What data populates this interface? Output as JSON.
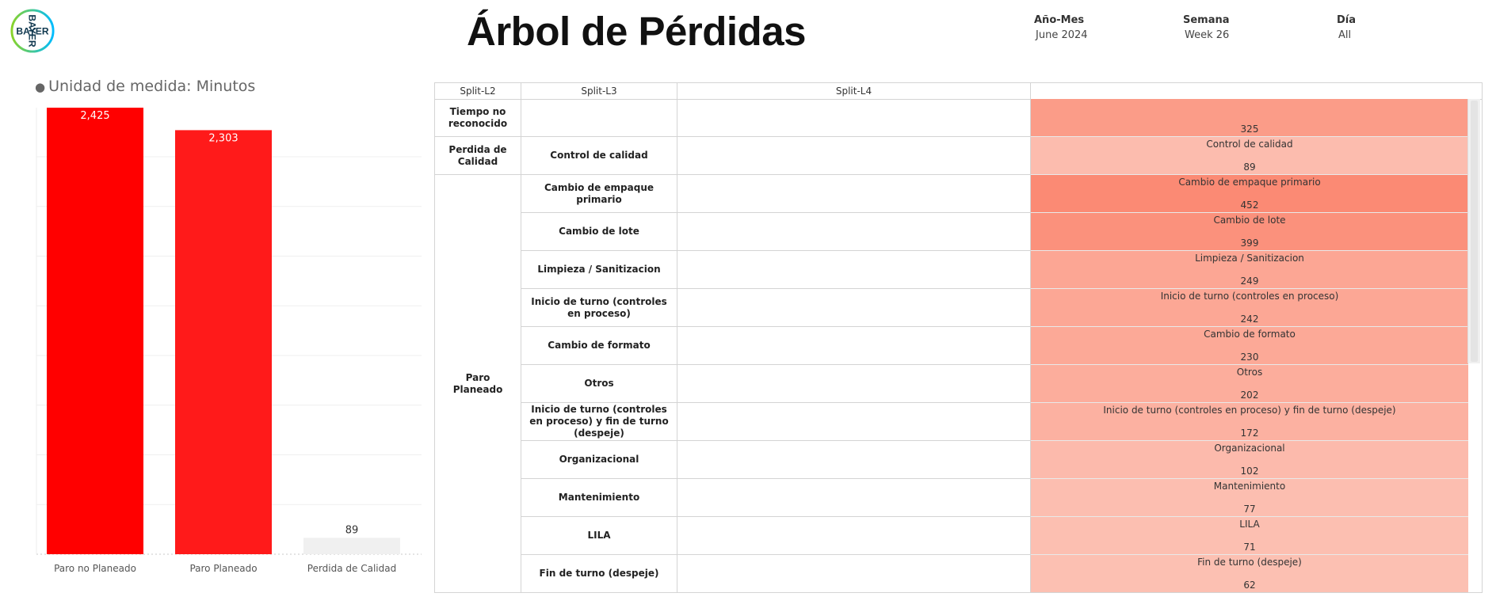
{
  "logo": {
    "text": "BAYER",
    "colors": [
      "#10384F",
      "#89D329",
      "#00BCFF"
    ]
  },
  "title": "Árbol de Pérdidas",
  "filters": [
    {
      "label": "Año-Mes",
      "value": "June 2024"
    },
    {
      "label": "Semana",
      "value": "Week 26"
    },
    {
      "label": "Día",
      "value": "All"
    }
  ],
  "unit_label": "Unidad de medida: Minutos",
  "chart_data": {
    "type": "bar",
    "categories": [
      "Paro no Planeado",
      "Paro Planeado",
      "Perdida de Calidad"
    ],
    "values": [
      2425,
      2303,
      89
    ],
    "value_labels": [
      "2,425",
      "2,303",
      "89"
    ],
    "colors": [
      "#ff0000",
      "#ff1a1a",
      "#f0f0f0"
    ],
    "ylim": [
      0,
      2425
    ],
    "grid": true
  },
  "tree": {
    "headers": [
      "Split-L2",
      "Split-L3",
      "Split-L4",
      ""
    ],
    "groups": [
      {
        "l2": "Tiempo no reconocido",
        "rows": [
          {
            "l3": "",
            "label": "",
            "value": 325
          }
        ]
      },
      {
        "l2": "Perdida de Calidad",
        "rows": [
          {
            "l3": "Control de calidad",
            "label": "Control de calidad",
            "value": 89
          }
        ]
      },
      {
        "l2": "Paro Planeado",
        "rows": [
          {
            "l3": "Cambio de empaque primario",
            "label": "Cambio de empaque primario",
            "value": 452
          },
          {
            "l3": "Cambio de lote",
            "label": "Cambio de lote",
            "value": 399
          },
          {
            "l3": "Limpieza / Sanitizacion",
            "label": "Limpieza / Sanitizacion",
            "value": 249
          },
          {
            "l3": "Inicio de turno (controles en proceso)",
            "label": "Inicio de turno (controles en proceso)",
            "value": 242
          },
          {
            "l3": "Cambio de formato",
            "label": "Cambio de formato",
            "value": 230
          },
          {
            "l3": "Otros",
            "label": "Otros",
            "value": 202
          },
          {
            "l3": "Inicio de turno (controles en proceso) y fin de turno (despeje)",
            "label": "Inicio de turno (controles en proceso) y fin de turno (despeje)",
            "value": 172
          },
          {
            "l3": "Organizacional",
            "label": "Organizacional",
            "value": 102
          },
          {
            "l3": "Mantenimiento",
            "label": "Mantenimiento",
            "value": 77
          },
          {
            "l3": "LILA",
            "label": "LILA",
            "value": 71
          },
          {
            "l3": "Fin de turno (despeje)",
            "label": "Fin de turno (despeje)",
            "value": 62
          }
        ]
      }
    ],
    "colors": {
      "low": "#fcc0b2",
      "high": "#fb8a74"
    }
  }
}
